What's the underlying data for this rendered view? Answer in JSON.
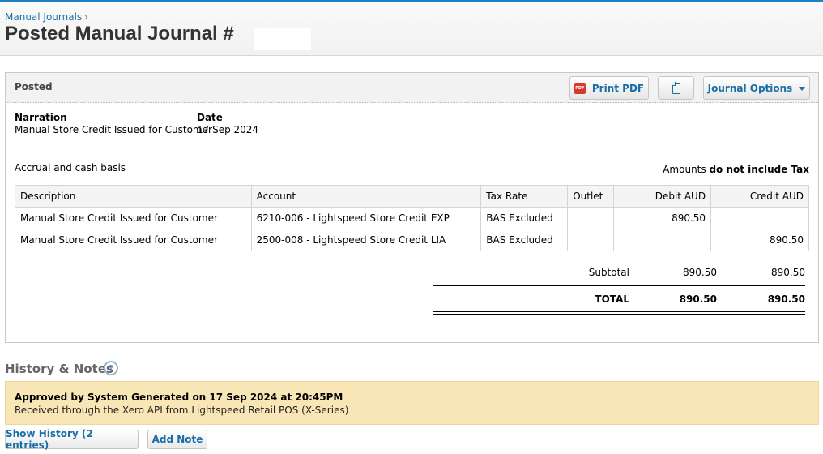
{
  "breadcrumb": {
    "parent": "Manual Journals",
    "separator": "›"
  },
  "page_title": "Posted Manual Journal #",
  "panel": {
    "status": "Posted",
    "buttons": {
      "print_pdf": "Print PDF",
      "journal_options": "Journal Options"
    },
    "narration_label": "Narration",
    "narration_value": "Manual Store Credit Issued for Customer",
    "date_label": "Date",
    "date_value": "17 Sep 2024",
    "basis": "Accrual and cash basis",
    "amounts_prefix": "Amounts",
    "amounts_bold": "do not include Tax"
  },
  "table": {
    "headers": [
      "Description",
      "Account",
      "Tax Rate",
      "Outlet",
      "Debit AUD",
      "Credit AUD"
    ],
    "rows": [
      {
        "description": "Manual Store Credit Issued for Customer",
        "account": "6210-006 - Lightspeed Store Credit EXP",
        "tax_rate": "BAS Excluded",
        "outlet": "",
        "debit": "890.50",
        "credit": ""
      },
      {
        "description": "Manual Store Credit Issued for Customer",
        "account": "2500-008 - Lightspeed Store Credit LIA",
        "tax_rate": "BAS Excluded",
        "outlet": "",
        "debit": "",
        "credit": "890.50"
      }
    ]
  },
  "totals": {
    "subtotal_label": "Subtotal",
    "subtotal_debit": "890.50",
    "subtotal_credit": "890.50",
    "total_label": "TOTAL",
    "total_debit": "890.50",
    "total_credit": "890.50"
  },
  "history": {
    "title": "History & Notes",
    "help": "?",
    "entry_title": "Approved by System Generated on 17 Sep 2024 at 20:45PM",
    "entry_detail": "Received through the Xero API from Lightspeed Retail POS (X-Series)",
    "show_history": "Show History (2 entries)",
    "add_note": "Add Note"
  },
  "colors": {
    "link": "#1a6ea8",
    "topbar": "#1e7fc5",
    "note_bg": "#f8e6b6"
  }
}
